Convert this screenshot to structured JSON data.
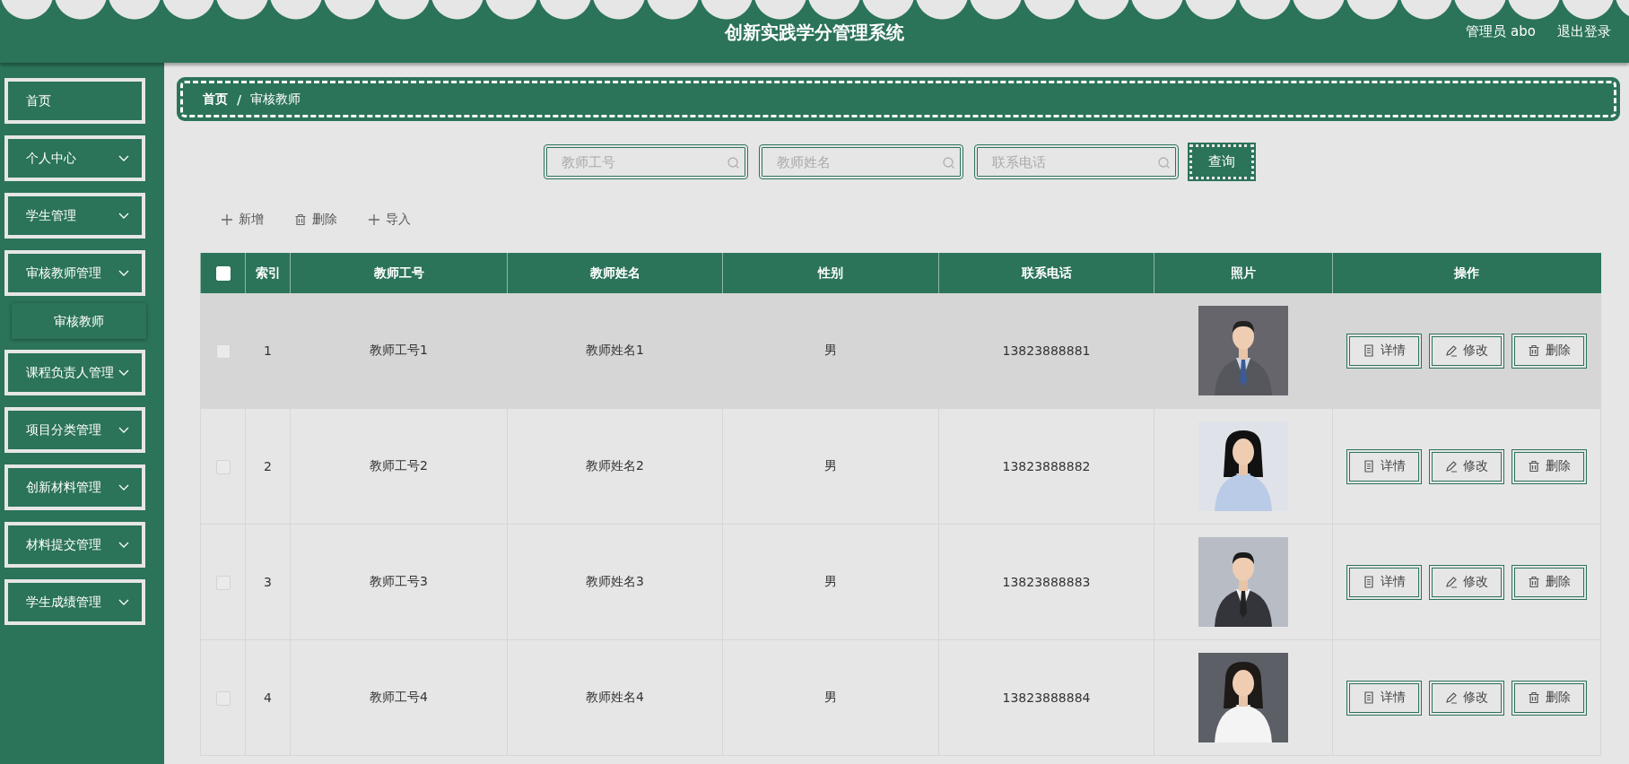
{
  "header": {
    "title": "创新实践学分管理系统",
    "user": "管理员 abo",
    "logout": "退出登录"
  },
  "sidebar": {
    "items": [
      {
        "label": "首页",
        "expandable": false
      },
      {
        "label": "个人中心",
        "expandable": true
      },
      {
        "label": "学生管理",
        "expandable": true
      },
      {
        "label": "审核教师管理",
        "expandable": true,
        "children": [
          {
            "label": "审核教师",
            "selected": true
          }
        ]
      },
      {
        "label": "课程负责人管理",
        "expandable": true
      },
      {
        "label": "项目分类管理",
        "expandable": true
      },
      {
        "label": "创新材料管理",
        "expandable": true
      },
      {
        "label": "材料提交管理",
        "expandable": true
      },
      {
        "label": "学生成绩管理",
        "expandable": true
      }
    ]
  },
  "breadcrumb": {
    "items": [
      "首页",
      "审核教师"
    ],
    "separator": "/"
  },
  "search": {
    "fields": [
      {
        "placeholder": "教师工号"
      },
      {
        "placeholder": "教师姓名"
      },
      {
        "placeholder": "联系电话"
      }
    ],
    "button": "查询"
  },
  "toolbar": [
    {
      "kind": "add",
      "label": "新增"
    },
    {
      "kind": "delete",
      "label": "删除"
    },
    {
      "kind": "import",
      "label": "导入"
    }
  ],
  "table": {
    "all_checked": false,
    "columns": [
      "索引",
      "教师工号",
      "教师姓名",
      "性别",
      "联系电话",
      "照片",
      "操作"
    ],
    "rows": [
      {
        "checked": false,
        "highlighted": true,
        "index": "1",
        "teacher_id": "教师工号1",
        "name": "教师姓名1",
        "gender": "男",
        "phone": "13823888881",
        "photo": {
          "kind": "picture"
        },
        "actions": [
          {
            "kind": "detail",
            "label": "详情"
          },
          {
            "kind": "edit",
            "label": "修改"
          },
          {
            "kind": "delete",
            "label": "删除"
          }
        ]
      },
      {
        "checked": false,
        "highlighted": false,
        "index": "2",
        "teacher_id": "教师工号2",
        "name": "教师姓名2",
        "gender": "男",
        "phone": "13823888882",
        "photo": {
          "kind": "picture"
        },
        "actions": [
          {
            "kind": "detail",
            "label": "详情"
          },
          {
            "kind": "edit",
            "label": "修改"
          },
          {
            "kind": "delete",
            "label": "删除"
          }
        ]
      },
      {
        "checked": false,
        "highlighted": false,
        "index": "3",
        "teacher_id": "教师工号3",
        "name": "教师姓名3",
        "gender": "男",
        "phone": "13823888883",
        "photo": {
          "kind": "picture"
        },
        "actions": [
          {
            "kind": "detail",
            "label": "详情"
          },
          {
            "kind": "edit",
            "label": "修改"
          },
          {
            "kind": "delete",
            "label": "删除"
          }
        ]
      },
      {
        "checked": false,
        "highlighted": false,
        "index": "4",
        "teacher_id": "教师工号4",
        "name": "教师姓名4",
        "gender": "男",
        "phone": "13823888884",
        "photo": {
          "kind": "picture"
        },
        "actions": [
          {
            "kind": "detail",
            "label": "详情"
          },
          {
            "kind": "edit",
            "label": "修改"
          },
          {
            "kind": "delete",
            "label": "删除"
          }
        ]
      }
    ]
  }
}
